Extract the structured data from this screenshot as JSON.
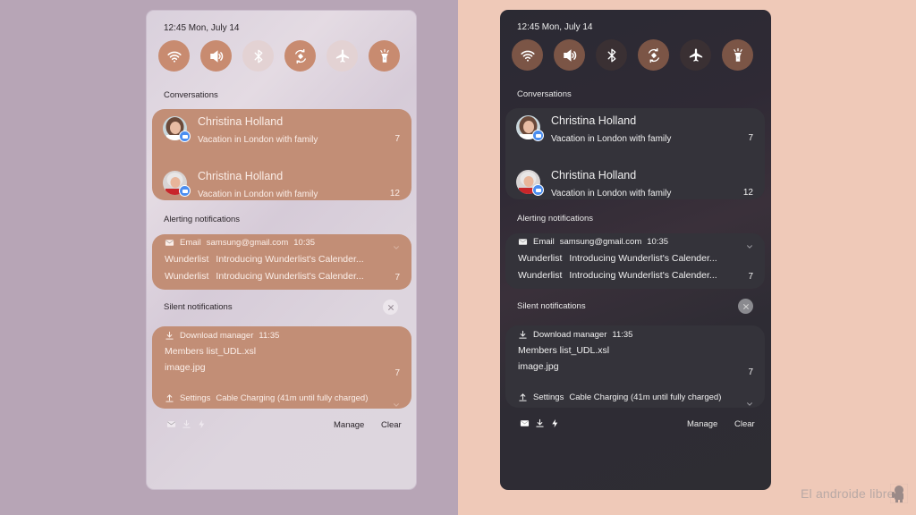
{
  "theme_colors": {
    "light_accent": "#c28e76",
    "light_tile_on": "#c88b70",
    "light_tile_off": "#e3d2d3",
    "dark_card": "#34333a",
    "dark_tile_on": "#7b5546",
    "dark_tile_off": "#3a3033",
    "badge_blue": "#4a8df0"
  },
  "panels": {
    "light": {
      "clock": "12:45 Mon, July 14",
      "quick_settings": [
        {
          "icon": "wifi-icon",
          "state": "on"
        },
        {
          "icon": "volume-icon",
          "state": "on"
        },
        {
          "icon": "bluetooth-icon",
          "state": "off"
        },
        {
          "icon": "auto-rotate-icon",
          "state": "on"
        },
        {
          "icon": "airplane-icon",
          "state": "off"
        },
        {
          "icon": "flashlight-icon",
          "state": "on"
        }
      ],
      "sections": {
        "conversations": "Conversations",
        "alerting": "Alerting notifications",
        "silent": "Silent notifications"
      },
      "conversations": [
        {
          "name": "Christina Holland",
          "message": "Vacation in London with family",
          "count": "7"
        },
        {
          "name": "Christina Holland",
          "message": "Vacation in London with family",
          "count": "12"
        }
      ],
      "email": {
        "app": "Email",
        "account": "samsung@gmail.com",
        "time": "10:35",
        "lines": [
          {
            "sender": "Wunderlist",
            "text": "Introducing Wunderlist's Calender..."
          },
          {
            "sender": "Wunderlist",
            "text": "Introducing Wunderlist's Calender..."
          }
        ],
        "count": "7"
      },
      "download": {
        "app": "Download manager",
        "time": "11:35",
        "lines": [
          "Members list_UDL.xsl",
          "image.jpg"
        ],
        "count": "7"
      },
      "settings": {
        "app": "Settings",
        "text": "Cable Charging (41m until fully charged)"
      },
      "footer": {
        "manage": "Manage",
        "clear": "Clear"
      }
    },
    "dark": {
      "clock": "12:45 Mon, July 14",
      "quick_settings": [
        {
          "icon": "wifi-icon",
          "state": "on"
        },
        {
          "icon": "volume-icon",
          "state": "on"
        },
        {
          "icon": "bluetooth-icon",
          "state": "off"
        },
        {
          "icon": "auto-rotate-icon",
          "state": "on"
        },
        {
          "icon": "airplane-icon",
          "state": "off"
        },
        {
          "icon": "flashlight-icon",
          "state": "on"
        }
      ],
      "sections": {
        "conversations": "Conversations",
        "alerting": "Alerting notifications",
        "silent": "Silent notifications"
      },
      "conversations": [
        {
          "name": "Christina Holland",
          "message": "Vacation in London with family",
          "count": "7"
        },
        {
          "name": "Christina Holland",
          "message": "Vacation in London with family",
          "count": "12"
        }
      ],
      "email": {
        "app": "Email",
        "account": "samsung@gmail.com",
        "time": "10:35",
        "lines": [
          {
            "sender": "Wunderlist",
            "text": "Introducing Wunderlist's Calender..."
          },
          {
            "sender": "Wunderlist",
            "text": "Introducing Wunderlist's Calender..."
          }
        ],
        "count": "7"
      },
      "download": {
        "app": "Download manager",
        "time": "11:35",
        "lines": [
          "Members list_UDL.xsl",
          "image.jpg"
        ],
        "count": "7"
      },
      "settings": {
        "app": "Settings",
        "text": "Cable Charging (41m until fully charged)"
      },
      "footer": {
        "manage": "Manage",
        "clear": "Clear"
      }
    }
  },
  "watermark": "El androide libre"
}
